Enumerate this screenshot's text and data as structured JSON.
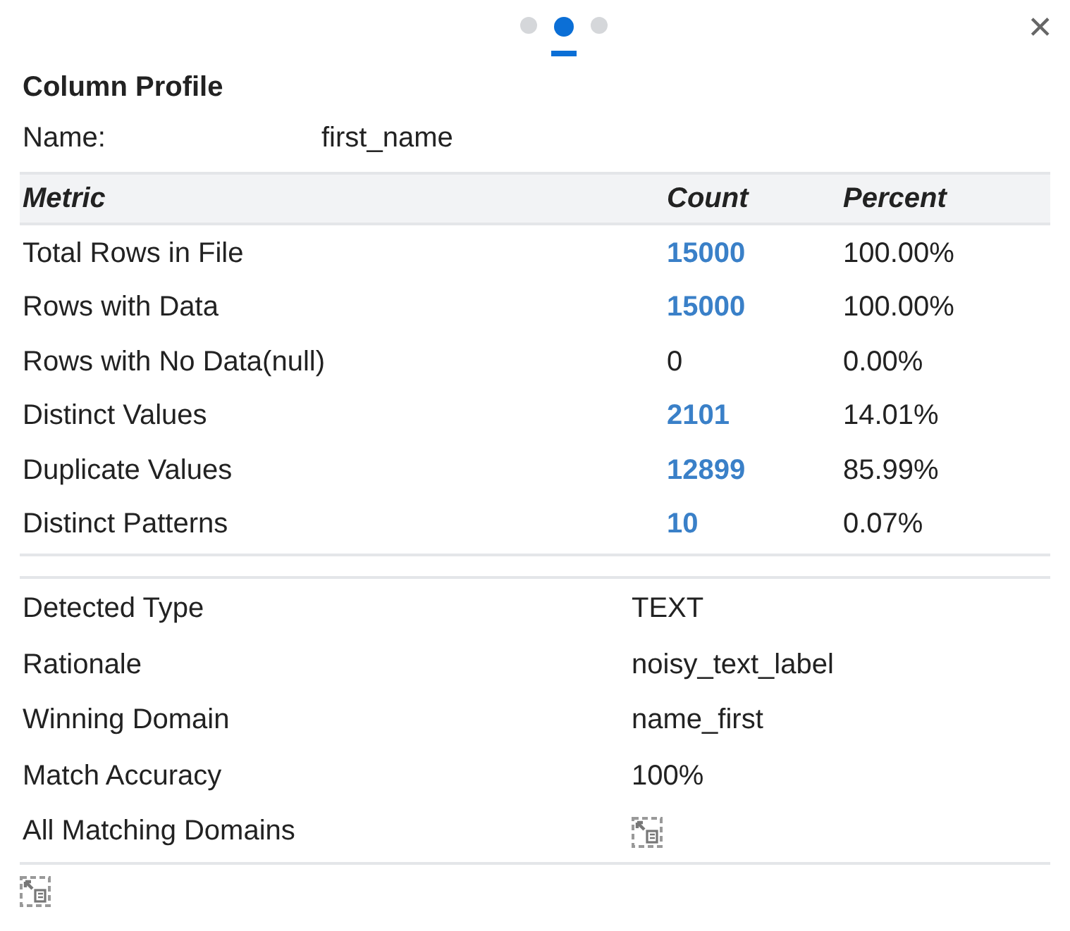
{
  "pager": [
    {
      "selected": false
    },
    {
      "selected": true
    },
    {
      "selected": false
    }
  ],
  "close": "✕",
  "title": "Column Profile",
  "name": {
    "label": "Name:",
    "value": "first_name"
  },
  "table": {
    "columns": [
      "Metric",
      "Count",
      "Percent"
    ],
    "rows": [
      {
        "metric": "Total Rows in File",
        "count": "15000",
        "link": true,
        "percent": "100.00%"
      },
      {
        "metric": "Rows with Data",
        "count": "15000",
        "link": true,
        "percent": "100.00%"
      },
      {
        "metric": "Rows with No Data(null)",
        "count": "0",
        "link": false,
        "percent": "0.00%"
      },
      {
        "metric": "Distinct Values",
        "count": "2101",
        "link": true,
        "percent": "14.01%"
      },
      {
        "metric": "Duplicate Values",
        "count": "12899",
        "link": true,
        "percent": "85.99%"
      },
      {
        "metric": "Distinct Patterns",
        "count": "10",
        "link": true,
        "percent": "0.07%"
      }
    ]
  },
  "details": [
    {
      "label": "Detected Type",
      "kind": "text",
      "value": "TEXT"
    },
    {
      "label": "Rationale",
      "kind": "text",
      "value": "noisy_text_label"
    },
    {
      "label": "Winning Domain",
      "kind": "text",
      "value": "name_first"
    },
    {
      "label": "Match Accuracy",
      "kind": "text",
      "value": "100%"
    },
    {
      "label": "All Matching Domains",
      "kind": "icon"
    }
  ]
}
